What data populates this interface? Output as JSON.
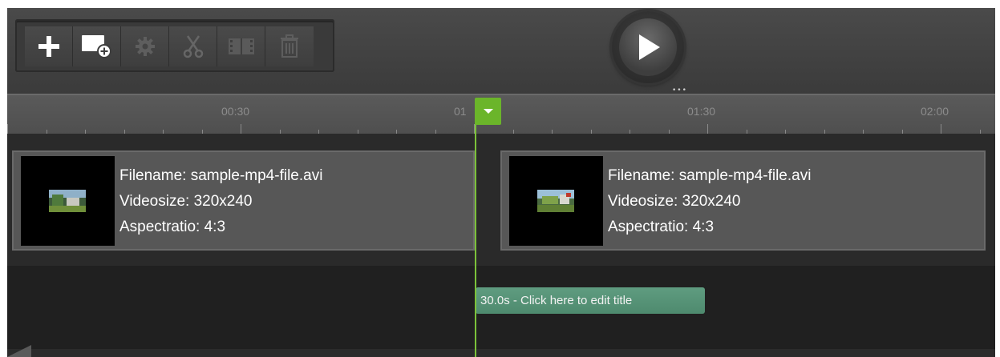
{
  "toolbar": {
    "buttons": [
      {
        "name": "add",
        "icon": "plus-icon",
        "enabled": true
      },
      {
        "name": "add-media",
        "icon": "add-media-icon",
        "enabled": true
      },
      {
        "name": "settings",
        "icon": "gear-icon",
        "enabled": false
      },
      {
        "name": "cut",
        "icon": "scissors-icon",
        "enabled": false
      },
      {
        "name": "filmstrip",
        "icon": "filmstrip-icon",
        "enabled": false
      },
      {
        "name": "delete",
        "icon": "trash-icon",
        "enabled": false
      }
    ],
    "play_icon": "play-icon"
  },
  "ruler": {
    "labels": [
      "00:30",
      "01",
      "01:30",
      "02:00"
    ]
  },
  "timeline": {
    "playhead_color": "#6bb52a",
    "clips": [
      {
        "filename": "Filename: sample-mp4-file.avi",
        "videosize": "Videosize: 320x240",
        "aspectratio": "Aspectratio: 4:3"
      },
      {
        "filename": "Filename: sample-mp4-file.avi",
        "videosize": "Videosize: 320x240",
        "aspectratio": "Aspectratio: 4:3"
      }
    ],
    "title_clip": "30.0s - Click here to edit title"
  }
}
